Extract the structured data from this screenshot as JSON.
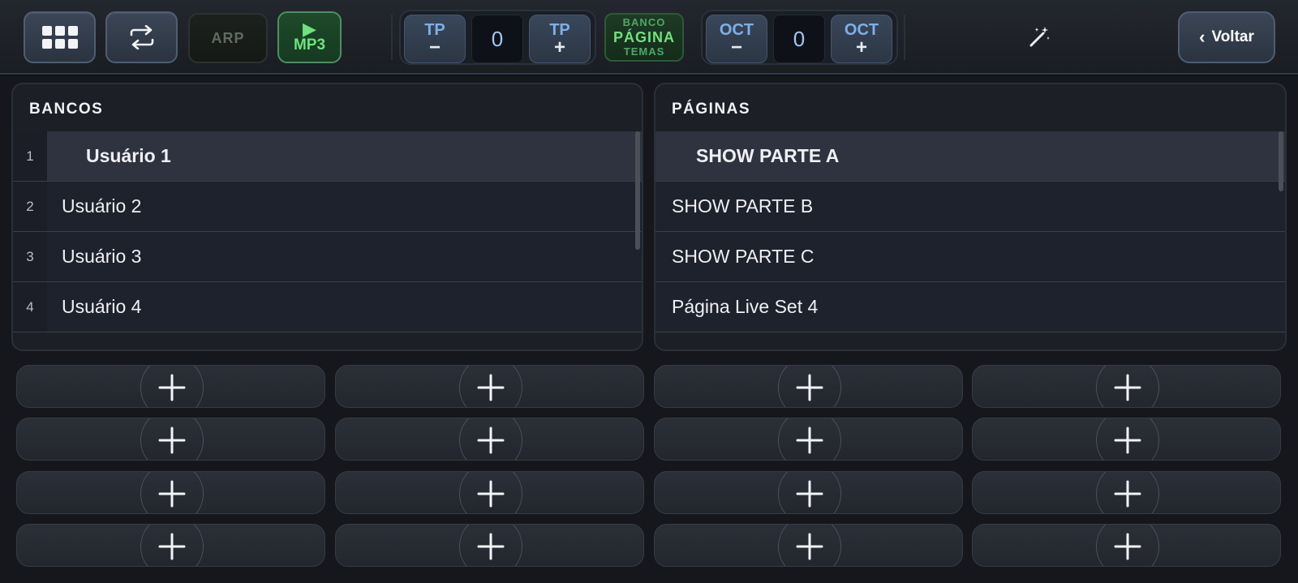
{
  "toolbar": {
    "arp_label": "ARP",
    "mp3_play": "▶",
    "mp3_label": "MP3",
    "tp_minus": {
      "top": "TP",
      "sign": "−"
    },
    "tp_value": "0",
    "tp_plus": {
      "top": "TP",
      "sign": "+"
    },
    "banco": {
      "top": "BANCO",
      "mid": "PÁGINA",
      "bot": "TEMAS"
    },
    "oct_minus": {
      "top": "OCT",
      "sign": "−"
    },
    "oct_value": "0",
    "oct_plus": {
      "top": "OCT",
      "sign": "+"
    },
    "back_chevron": "‹",
    "back_label": "Voltar",
    "icons": [
      "grid-icon",
      "repeat-icon",
      "magic-wand-icon",
      "chevron-left-icon"
    ]
  },
  "bancos": {
    "title": "BANCOS",
    "items": [
      {
        "num": "1",
        "label": "Usuário 1"
      },
      {
        "num": "2",
        "label": "Usuário 2"
      },
      {
        "num": "3",
        "label": "Usuário 3"
      },
      {
        "num": "4",
        "label": "Usuário 4"
      }
    ]
  },
  "paginas": {
    "title": "PÁGINAS",
    "items": [
      {
        "label": "SHOW PARTE A"
      },
      {
        "label": "SHOW PARTE B"
      },
      {
        "label": "SHOW PARTE C"
      },
      {
        "label": "Página Live Set 4"
      }
    ]
  },
  "slots": {
    "count": 16,
    "icon": "plus-icon"
  },
  "colors": {
    "background": "#15171c",
    "accent_green": "#6ee27e",
    "accent_blue": "#7fb0e8"
  }
}
